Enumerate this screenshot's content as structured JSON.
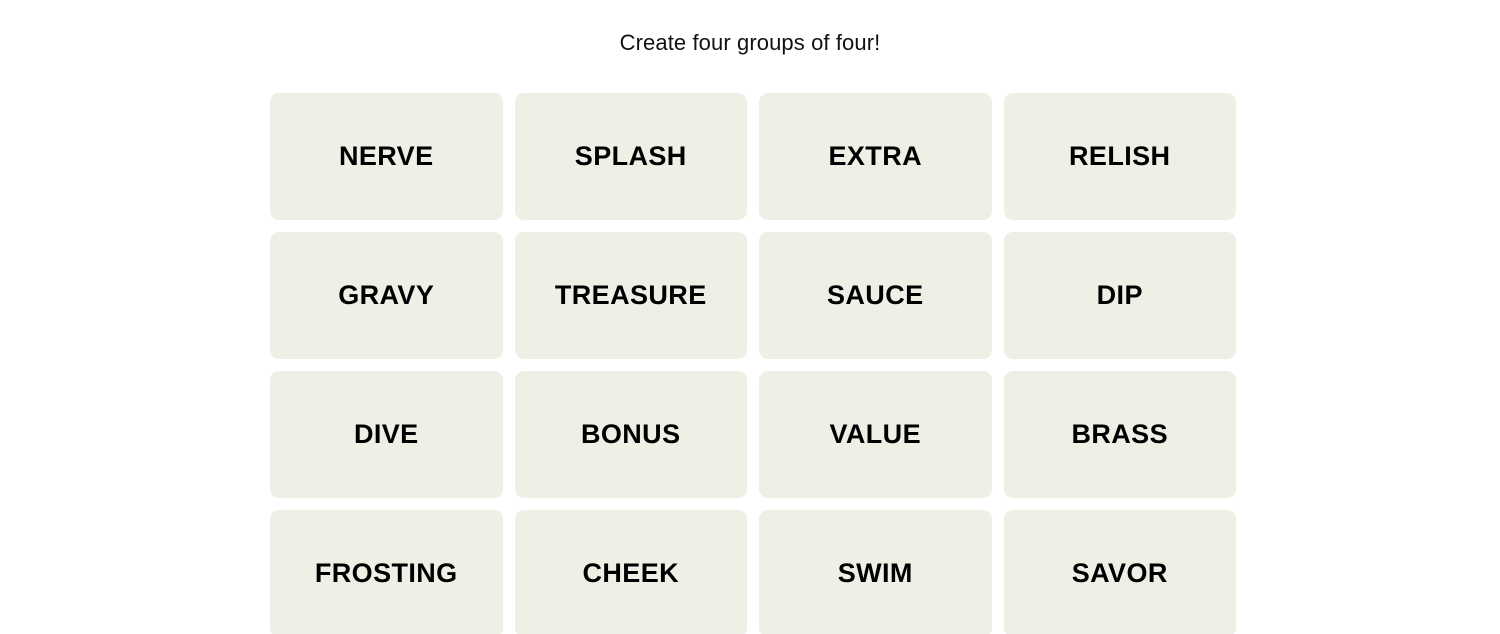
{
  "page": {
    "background_color": "#ffffff"
  },
  "header": {
    "instruction": "Create four groups of four!"
  },
  "board": {
    "rows": 4,
    "columns": 4,
    "tile_background_color": "#efefe6",
    "tile_text_color": "#000000",
    "tiles": [
      {
        "label": "NERVE"
      },
      {
        "label": "SPLASH"
      },
      {
        "label": "EXTRA"
      },
      {
        "label": "RELISH"
      },
      {
        "label": "GRAVY"
      },
      {
        "label": "TREASURE"
      },
      {
        "label": "SAUCE"
      },
      {
        "label": "DIP"
      },
      {
        "label": "DIVE"
      },
      {
        "label": "BONUS"
      },
      {
        "label": "VALUE"
      },
      {
        "label": "BRASS"
      },
      {
        "label": "FROSTING"
      },
      {
        "label": "CHEEK"
      },
      {
        "label": "SWIM"
      },
      {
        "label": "SAVOR"
      }
    ]
  }
}
